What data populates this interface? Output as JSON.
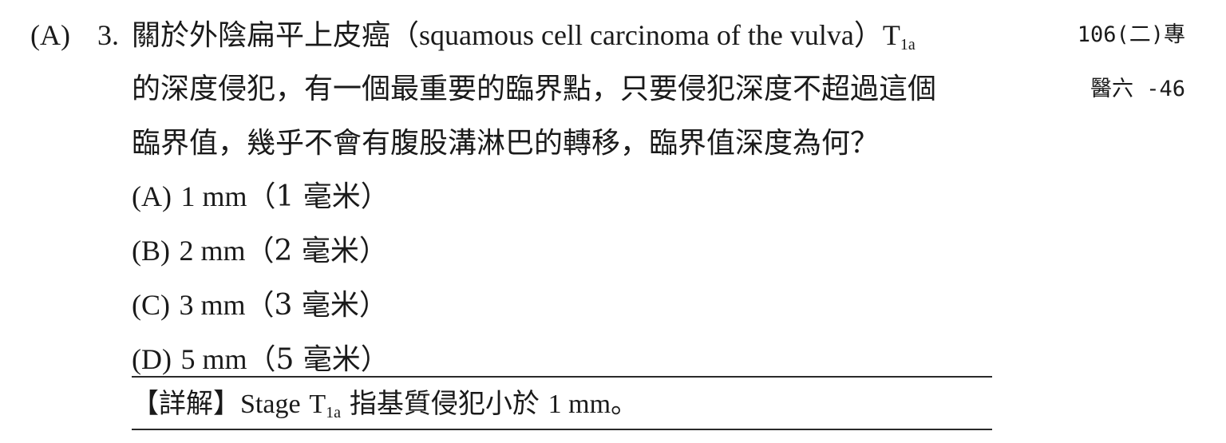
{
  "answer": "(A)",
  "question": {
    "number": "3.",
    "line1_a": "關於外陰扁平上皮癌（",
    "line1_latin": "squamous cell carcinoma of the vulva",
    "line1_b": "）",
    "t_main": "T",
    "t_sub": "1a",
    "line2": "的深度侵犯，有一個最重要的臨界點，只要侵犯深度不超過這個",
    "line3": "臨界值，幾乎不會有腹股溝淋巴的轉移，臨界值深度為何？"
  },
  "source": {
    "line1": "106(二)專",
    "line2": "醫六 -46"
  },
  "options": [
    {
      "letter": "(A)",
      "value": "1 mm",
      "note": "（1 毫米）"
    },
    {
      "letter": "(B)",
      "value": "2 mm",
      "note": "（2 毫米）"
    },
    {
      "letter": "(C)",
      "value": "3 mm",
      "note": "（3 毫米）"
    },
    {
      "letter": "(D)",
      "value": "5 mm",
      "note": "（5 毫米）"
    }
  ],
  "explanation": {
    "label": "【詳解】",
    "stage": "Stage",
    "t_main": "T",
    "t_sub": "1a",
    "text": "指基質侵犯小於",
    "value": "1 mm",
    "end": "。"
  }
}
